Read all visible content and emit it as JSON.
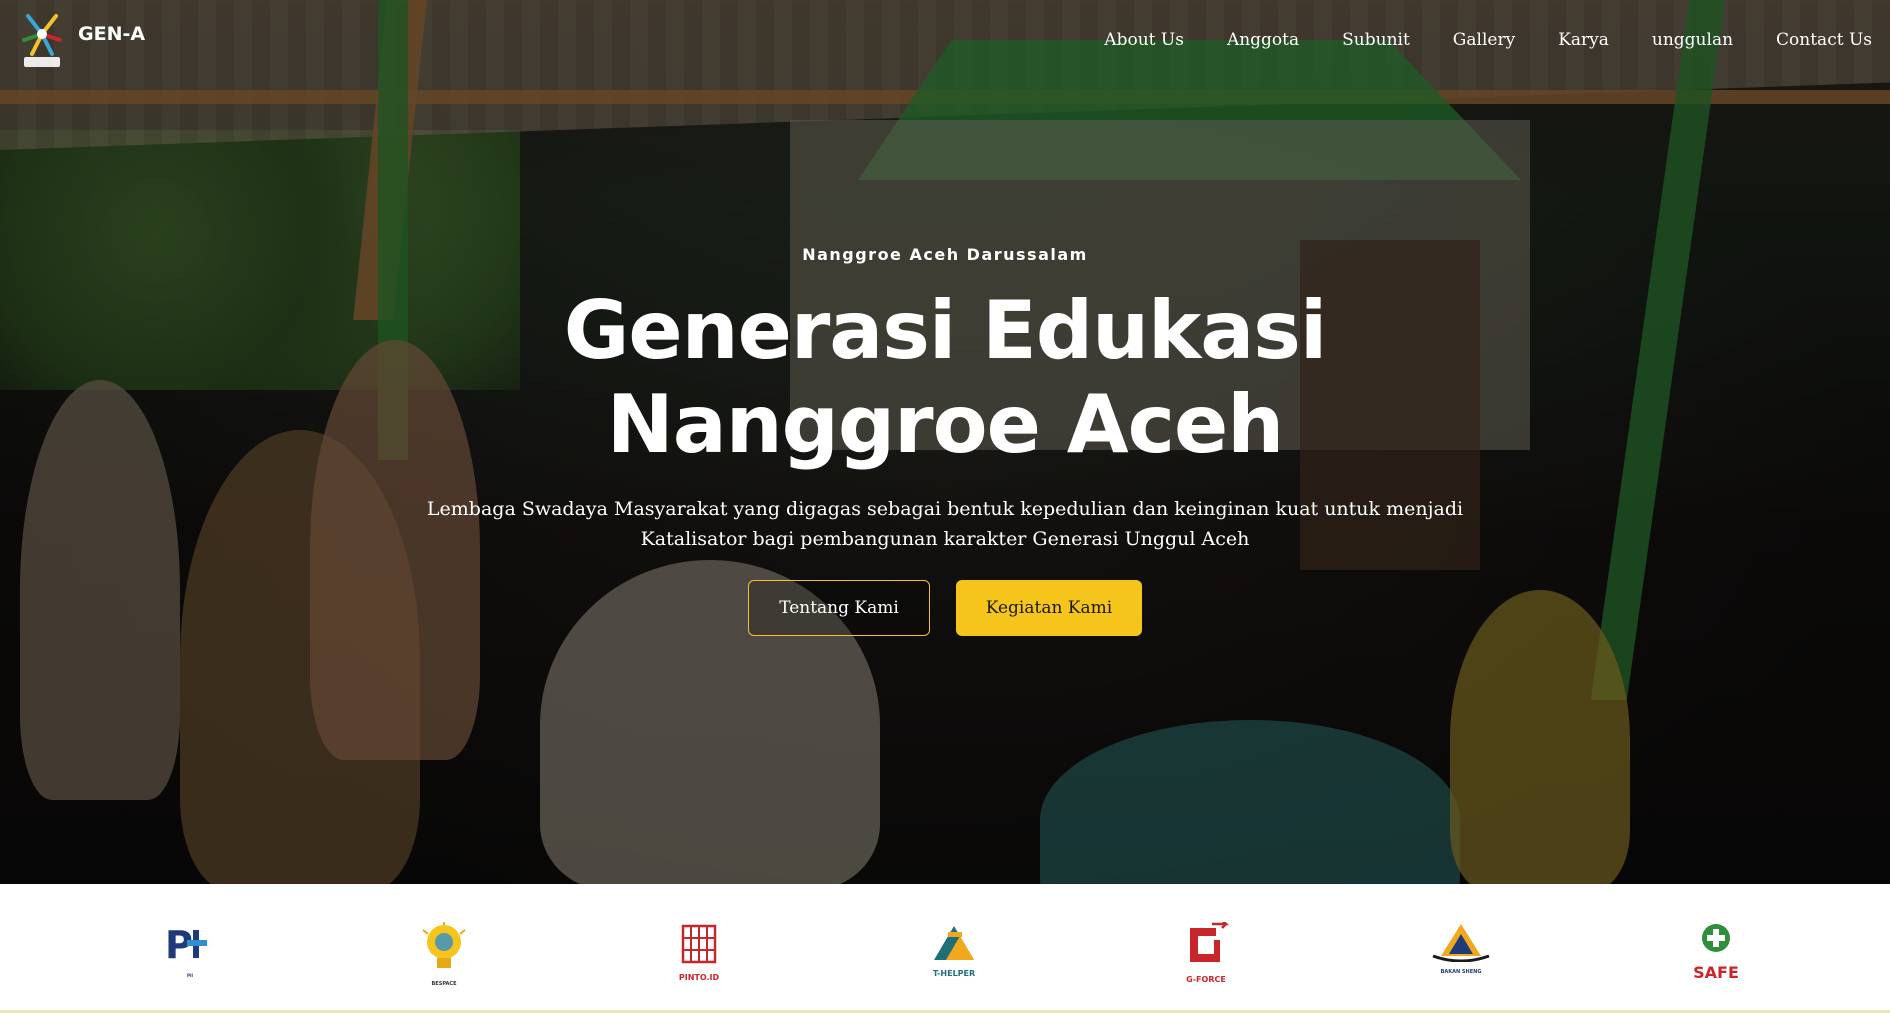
{
  "brand": {
    "name": "GEN-A",
    "logo_icon": "gen-a-logo-icon",
    "logo_text": "GEN-A"
  },
  "nav": {
    "items": [
      "About Us",
      "Anggota",
      "Subunit",
      "Gallery",
      "Karya",
      "unggulan",
      "Contact Us"
    ]
  },
  "hero": {
    "eyebrow": "Nanggroe Aceh Darussalam",
    "title_line1": "Generasi Edukasi",
    "title_line2": "Nanggroe Aceh",
    "desc_line1": "Lembaga Swadaya Masyarakat yang digagas sebagai bentuk kepedulian dan keinginan kuat untuk menjadi",
    "desc_line2": "Katalisator bagi pembangunan karakter Generasi Unggul Aceh",
    "btn_primary": "Tentang Kami",
    "btn_secondary": "Kegiatan Kami"
  },
  "partners": [
    {
      "icon": "pii-logo-icon",
      "label": "PII"
    },
    {
      "icon": "bespace-logo-icon",
      "label": "BESPACE"
    },
    {
      "icon": "pinto-logo-icon",
      "label": "PINTO.ID"
    },
    {
      "icon": "t-helper-logo-icon",
      "label": "T-HELPER"
    },
    {
      "icon": "g-force-logo-icon",
      "label": "G-FORCE"
    },
    {
      "icon": "bakan-sheng-logo-icon",
      "label": "BAKAN SHENG"
    },
    {
      "icon": "safe-logo-icon",
      "label": "SAFE"
    }
  ],
  "colors": {
    "accent": "#f5c51c",
    "text_light": "#ffffff",
    "partner_red": "#c8262b",
    "partner_navy": "#1e3a78",
    "partner_green": "#2e8f3a"
  }
}
